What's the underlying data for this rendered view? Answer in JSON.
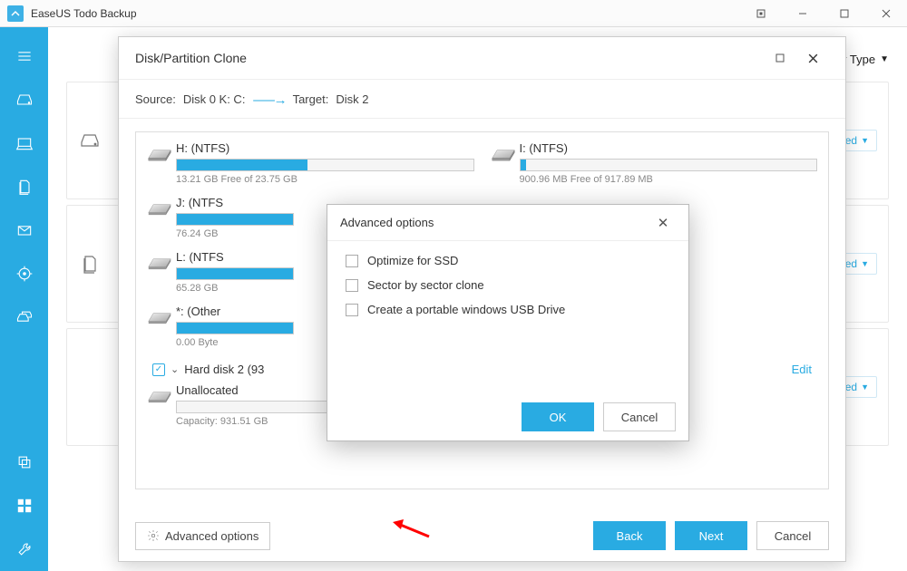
{
  "titlebar": {
    "title": "EaseUS Todo Backup"
  },
  "top_right": {
    "sort_label": "Sort by Type"
  },
  "bg": {
    "advanced_label": "Advanced"
  },
  "clone": {
    "title": "Disk/Partition Clone",
    "source_label": "Source:",
    "source_value": "Disk 0 K: C:",
    "target_label": "Target:",
    "target_value": "Disk 2",
    "edit_label": "Edit",
    "partitions": {
      "h": {
        "label": "H: (NTFS)",
        "sub": "13.21 GB Free of 23.75 GB",
        "fill": 44
      },
      "i": {
        "label": "I: (NTFS)",
        "sub": "900.96 MB Free of 917.89 MB",
        "fill": 2
      },
      "j": {
        "label": "J: (NTFS",
        "sub": "76.24 GB",
        "fill": 100
      },
      "l": {
        "label": "L: (NTFS",
        "sub": "65.28 GB",
        "fill": 100
      },
      "star": {
        "label": "*: (Other",
        "sub": "0.00 Byte",
        "fill": 100
      },
      "disk2": {
        "label": "Hard disk 2 (93"
      },
      "unalloc": {
        "label": "Unallocated",
        "sub": "Capacity: 931.51 GB",
        "fill": 0
      }
    },
    "footer": {
      "advanced_options": "Advanced options",
      "back": "Back",
      "next": "Next",
      "cancel": "Cancel"
    }
  },
  "popup": {
    "title": "Advanced options",
    "opt1": "Optimize for SSD",
    "opt2": "Sector by sector clone",
    "opt3": "Create a portable windows USB Drive",
    "ok": "OK",
    "cancel": "Cancel"
  }
}
